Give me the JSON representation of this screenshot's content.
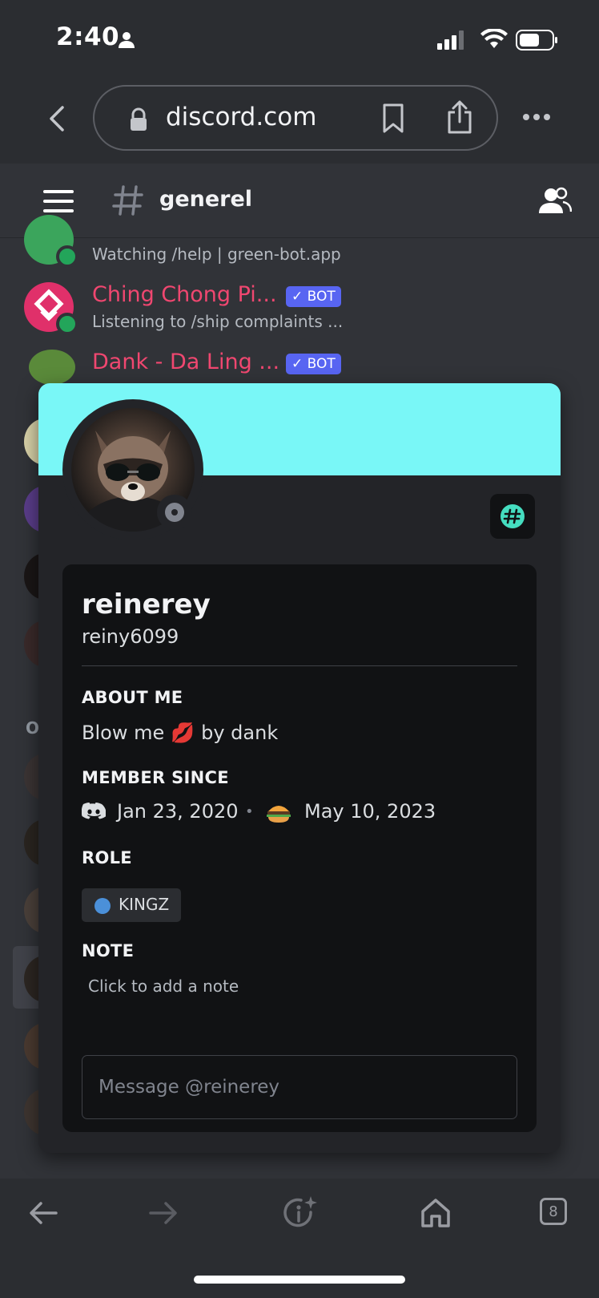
{
  "status_bar": {
    "time": "2:40"
  },
  "browser": {
    "url": "discord.com",
    "tab_count": "8"
  },
  "channel": {
    "name": "generel"
  },
  "members": [
    {
      "status": "Watching /help | green-bot.app"
    },
    {
      "name": "Ching Chong Pi...",
      "badge": "✓ BOT",
      "status": "Listening to /ship complaints ..."
    },
    {
      "name": "Dank - Da Ling ...",
      "badge": "✓ BOT"
    }
  ],
  "member_group_letter": "O",
  "profile": {
    "display_name": "reinerey",
    "username": "reiny6099",
    "about_me_heading": "ABOUT ME",
    "about_me_prefix": "Blow me",
    "about_me_emoji": "💋",
    "about_me_suffix": "by dank",
    "member_since_heading": "MEMBER SINCE",
    "discord_since": "Jan 23, 2020",
    "server_since": "May 10, 2023",
    "separator": "•",
    "role_heading": "ROLE",
    "role_name": "KINGZ",
    "role_color": "#4b90d9",
    "note_heading": "NOTE",
    "note_placeholder": "Click to add a note",
    "message_placeholder": "Message @reinerey",
    "banner_color": "#79f7f7"
  }
}
